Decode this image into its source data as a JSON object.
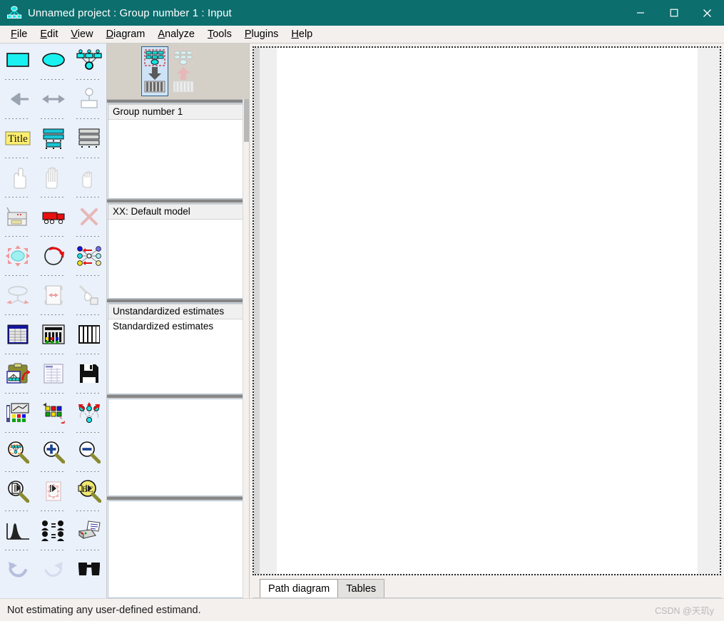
{
  "window": {
    "title": "Unnamed project : Group number 1 : Input",
    "app_icon": "amos-icon",
    "accent_color": "#0d6e6e",
    "controls": [
      {
        "name": "minimize-button",
        "glyph": "minimize-icon"
      },
      {
        "name": "maximize-button",
        "glyph": "maximize-icon"
      },
      {
        "name": "close-button",
        "glyph": "close-icon"
      }
    ]
  },
  "menubar": {
    "items": [
      {
        "label": "File",
        "mnemonic": "F"
      },
      {
        "label": "Edit",
        "mnemonic": "E"
      },
      {
        "label": "View",
        "mnemonic": "V"
      },
      {
        "label": "Diagram",
        "mnemonic": "D"
      },
      {
        "label": "Analyze",
        "mnemonic": "A"
      },
      {
        "label": "Tools",
        "mnemonic": "T"
      },
      {
        "label": "Plugins",
        "mnemonic": "P"
      },
      {
        "label": "Help",
        "mnemonic": "H"
      }
    ]
  },
  "toolbox": {
    "rows": [
      [
        "draw-observed-variable-icon",
        "draw-unobserved-variable-icon",
        "draw-latent-with-indicators-icon"
      ],
      [
        "draw-path-icon",
        "draw-covariance-icon",
        "add-unique-variable-icon"
      ],
      [
        "figure-caption-icon",
        "list-variables-in-dataset-icon",
        "list-variables-in-model-icon"
      ],
      [
        "select-one-object-icon",
        "select-all-objects-icon",
        "deselect-all-objects-icon"
      ],
      [
        "duplicate-object-icon",
        "move-object-icon",
        "erase-object-icon"
      ],
      [
        "change-shape-of-object-icon",
        "rotate-indicators-icon",
        "reflect-indicators-icon"
      ],
      [
        "move-parameter-values-icon",
        "scroll-diagram-icon",
        "touch-up-variable-icon"
      ],
      [
        "select-data-file-icon",
        "analysis-properties-icon",
        "object-properties-icon"
      ],
      [
        "copy-to-clipboard-icon",
        "view-text-output-icon",
        "save-current-diagram-icon"
      ],
      [
        "object-properties-2-icon",
        "drag-properties-icon",
        "preserve-symmetries-icon"
      ],
      [
        "zoom-select-icon",
        "zoom-in-icon",
        "zoom-out-icon"
      ],
      [
        "zoom-page-icon",
        "fit-to-page-icon",
        "loupe-magnify-icon"
      ],
      [
        "bayesian-estimation-icon",
        "multiple-group-analysis-icon",
        "print-icon"
      ],
      [
        "undo-icon",
        "redo-icon",
        "search-icon"
      ]
    ],
    "footer_handles": [
      "resize-handle-1",
      "resize-handle-2",
      "resize-handle-3"
    ]
  },
  "midpanel": {
    "toolstrip": {
      "buttons": [
        {
          "name": "view-input-path-diagram-button",
          "icon": "input-path-diagram-icon",
          "selected": true
        },
        {
          "name": "view-output-path-diagram-button",
          "icon": "output-path-diagram-icon",
          "selected": false
        }
      ]
    },
    "groups": {
      "items": [
        {
          "label": "Group number 1",
          "selected": true
        }
      ]
    },
    "models": {
      "items": [
        {
          "label": "XX: Default model",
          "selected": true
        }
      ]
    },
    "views": {
      "items": [
        {
          "label": "Unstandardized estimates",
          "selected": true
        },
        {
          "label": "Standardized estimates",
          "selected": false
        }
      ]
    },
    "blank_panel_1": {
      "items": []
    },
    "blank_panel_2": {
      "items": []
    }
  },
  "canvas": {
    "page_background": "#ffffff",
    "margin_background": "#efefef"
  },
  "tabs": {
    "items": [
      {
        "label": "Path diagram",
        "active": true
      },
      {
        "label": "Tables",
        "active": false
      }
    ]
  },
  "statusbar": {
    "message": "Not estimating any user-defined estimand.",
    "watermark": "CSDN @天玑y"
  }
}
